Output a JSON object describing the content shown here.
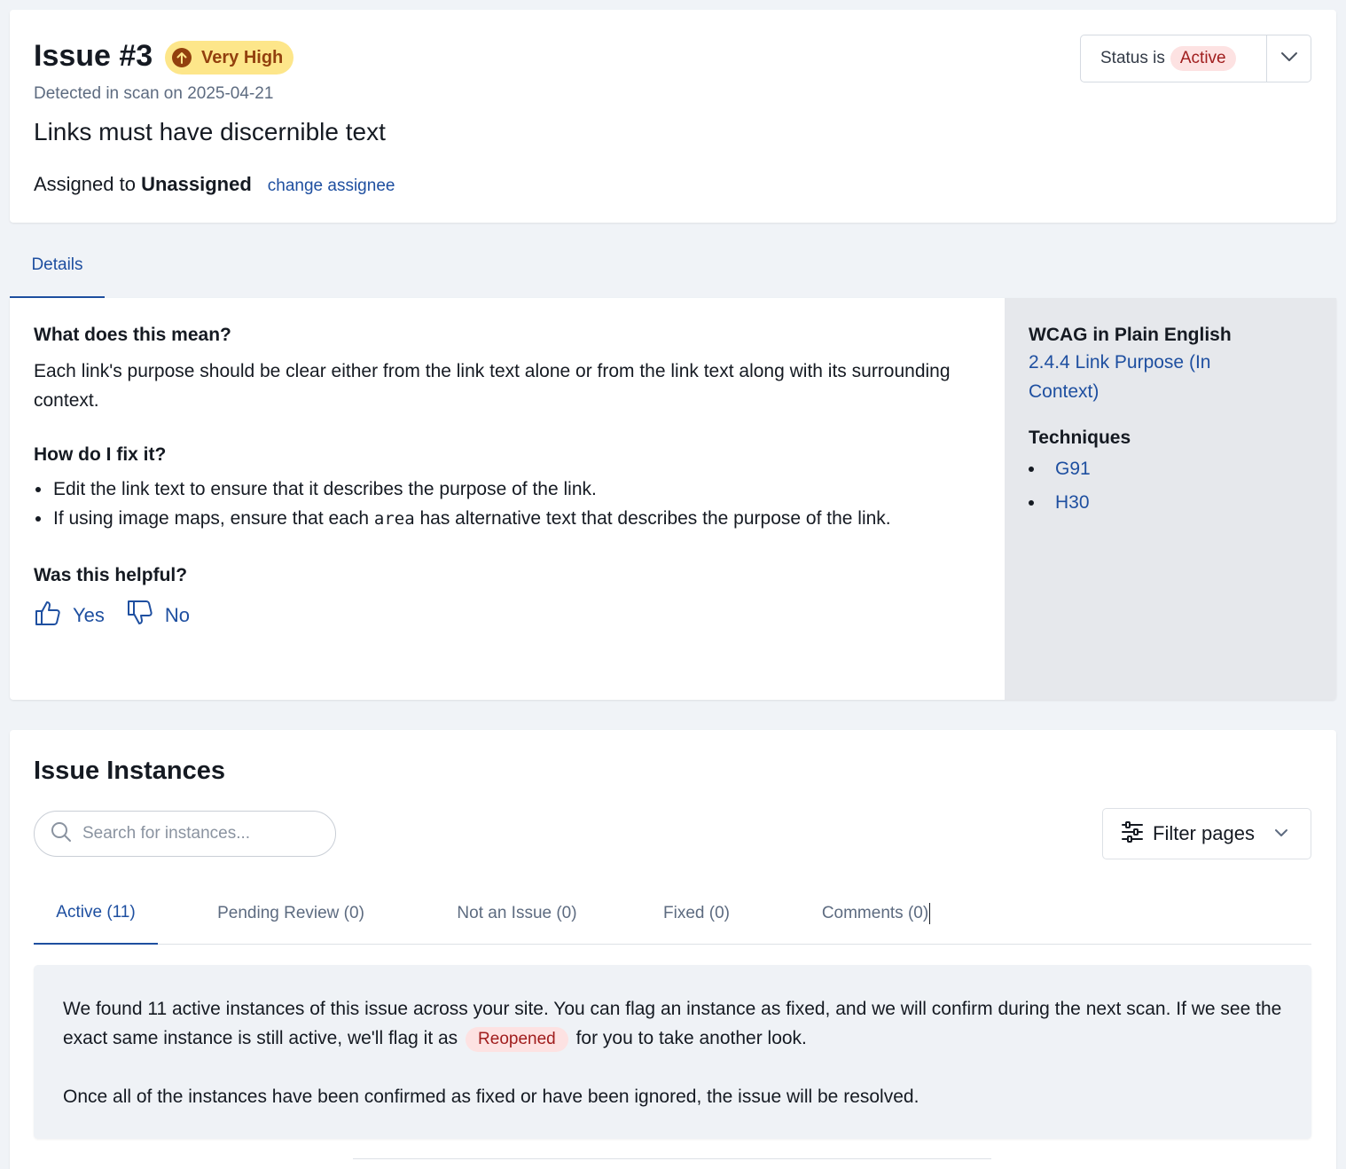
{
  "issue": {
    "title": "Issue #3",
    "severity": "Very High",
    "detected": "Detected in scan on 2025-04-21",
    "name": "Links must have discernible text",
    "assigned_prefix": "Assigned to ",
    "assignee": "Unassigned",
    "change_assignee": "change assignee",
    "status_prefix": "Status is",
    "status": "Active"
  },
  "colors": {
    "accent": "#1e4fa0",
    "severity_bg": "#fde68a",
    "severity_text": "#92400e",
    "status_bg": "#fde2e2",
    "status_text": "#a01d1d"
  },
  "tabs": {
    "details": "Details"
  },
  "details": {
    "what_heading": "What does this mean?",
    "what_body": "Each link's purpose should be clear either from the link text alone or from the link text along with its surrounding context.",
    "fix_heading": "How do I fix it?",
    "fix_item_1": "Edit the link text to ensure that it describes the purpose of the link.",
    "fix_item_2_before": "If using image maps, ensure that each ",
    "fix_item_2_code": "area",
    "fix_item_2_after": " has alternative text that describes the purpose of the link.",
    "helpful_heading": "Was this helpful?",
    "yes": "Yes",
    "no": "No"
  },
  "sidebar": {
    "wcag_heading": "WCAG in Plain English",
    "wcag_link": "2.4.4 Link Purpose (In Context)",
    "techniques_heading": "Techniques",
    "techniques": [
      "G91",
      "H30"
    ]
  },
  "instances": {
    "title": "Issue Instances",
    "search_placeholder": "Search for instances...",
    "filter_label": "Filter pages",
    "tabs": [
      "Active (11)",
      "Pending Review (0)",
      "Not an Issue (0)",
      "Fixed (0)",
      "Comments (0)"
    ],
    "info_1_before": "We found 11 active instances of this issue across your site. You can flag an instance as fixed, and we will confirm during the next scan. If we see the exact same instance is still active, we'll flag it as ",
    "info_1_badge": "Reopened",
    "info_1_after": " for you to take another look.",
    "info_2": "Once all of the instances have been confirmed as fixed or have been ignored, the issue will be resolved."
  }
}
